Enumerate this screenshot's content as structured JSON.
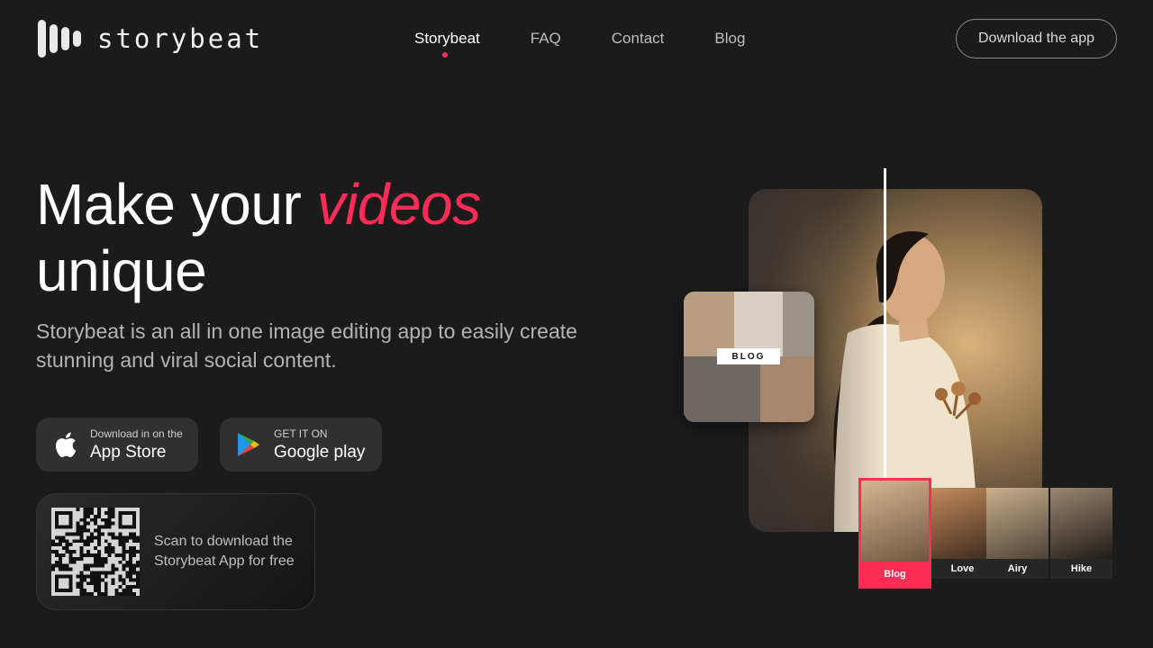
{
  "brand": {
    "name": "storybeat"
  },
  "nav": {
    "items": [
      "Storybeat",
      "FAQ",
      "Contact",
      "Blog"
    ],
    "active": "Storybeat"
  },
  "header": {
    "download_label": "Download the app"
  },
  "hero": {
    "headline_part1": "Make your ",
    "headline_accent": "videos",
    "headline_part2": "unique",
    "subtitle": "Storybeat is an all in one image editing app to easily create stunning and viral social content."
  },
  "stores": {
    "appstore": {
      "small": "Download in on the",
      "big": "App Store",
      "icon": "apple-icon"
    },
    "googleplay": {
      "small": "GET IT ON",
      "big": "Google play",
      "icon": "google-play-icon"
    }
  },
  "qr": {
    "text": "Scan to download the Storybeat App for free"
  },
  "collage": {
    "tag": "BLOG"
  },
  "filters": [
    {
      "label": "Blog",
      "active": true
    },
    {
      "label": "Love",
      "active": false
    },
    {
      "label": "Airy",
      "active": false
    },
    {
      "label": "Hike",
      "active": false
    }
  ],
  "colors": {
    "accent": "#ff2d55",
    "background": "#1b1b1b"
  }
}
